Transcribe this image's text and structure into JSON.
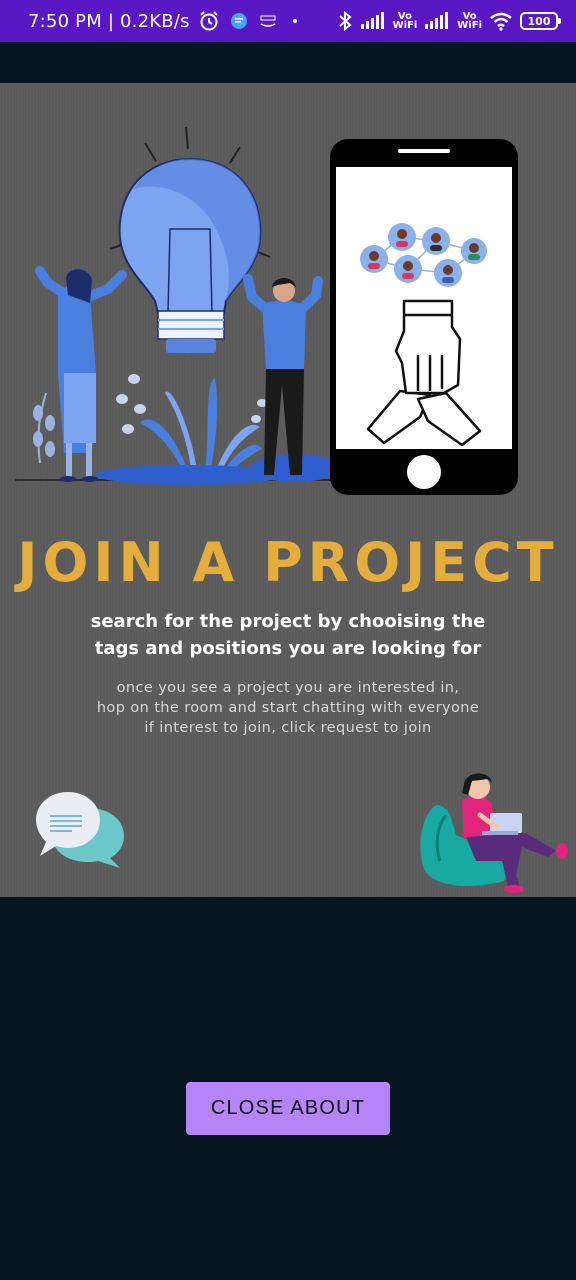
{
  "status_bar": {
    "time": "7:50 PM | 0.2KB/s",
    "vowifi_1": "Vo WiFi",
    "vowifi_2": "Vo WiFi",
    "battery": "100",
    "icons": [
      "alarm-icon",
      "message-icon",
      "amazon-icon",
      "dot-icon",
      "bluetooth-icon",
      "signal-icon",
      "wifi-icon",
      "battery-icon"
    ]
  },
  "about": {
    "headline": "JOIN A PROJECT",
    "subtitle_line1": "search for the project by chooising the",
    "subtitle_line2": "tags and positions you are looking for",
    "body_line1": "once you see a project you are interested in,",
    "body_line2": "hop on the room and start chatting with everyone",
    "body_line3": "if interest to join, click request to join",
    "colors": {
      "headline": "#e5ad3c",
      "card_bg": "#5b5b5b",
      "accent_blue": "#4a7fe0"
    }
  },
  "close_button": {
    "label": "CLOSE ABOUT",
    "color": "#b585f7"
  },
  "colors": {
    "status_bar": "#5a17c4",
    "background": "#061520"
  }
}
